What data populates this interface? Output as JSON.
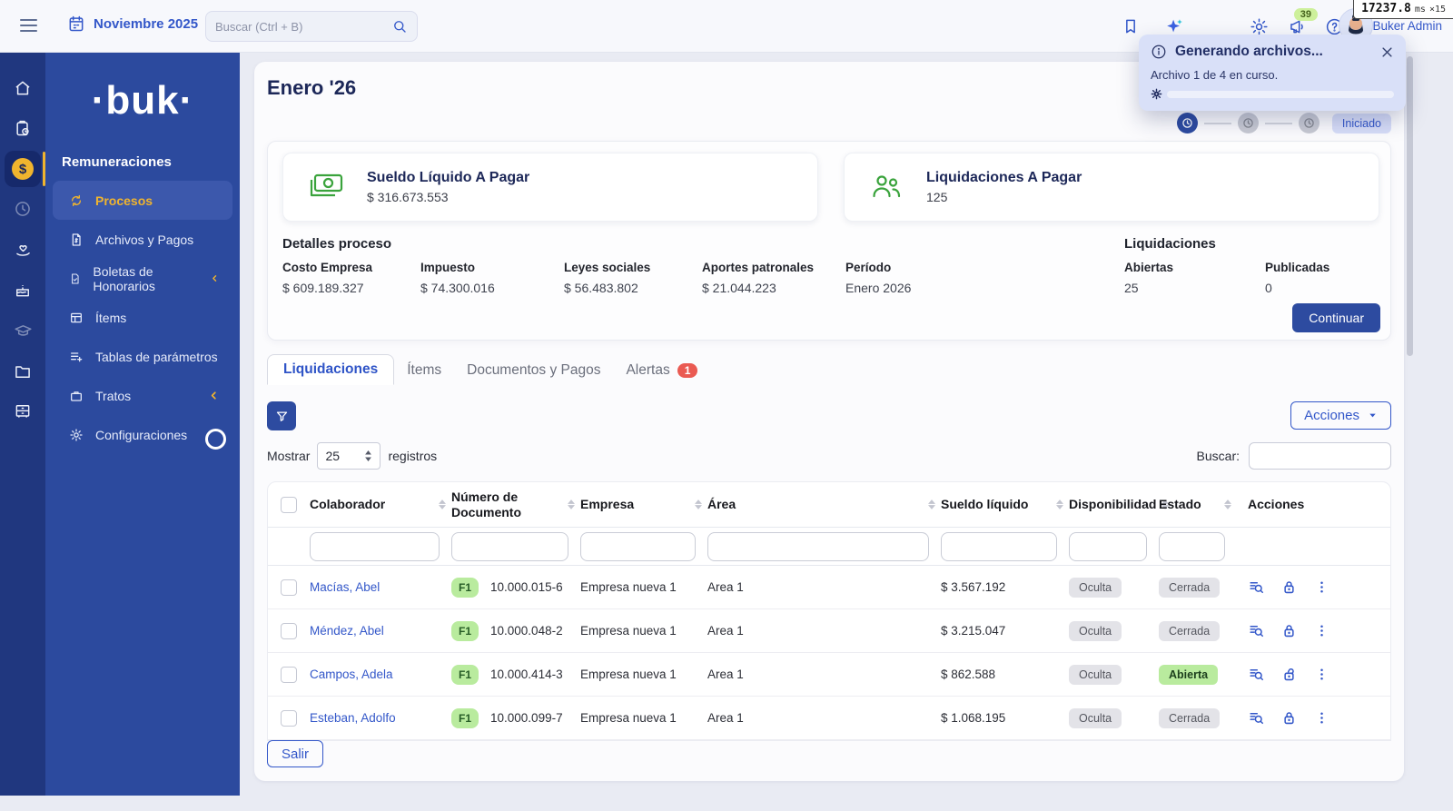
{
  "topbar": {
    "period": "Noviembre 2025",
    "search_placeholder": "Buscar (Ctrl + B)",
    "notifications_count": "39",
    "user_name": "Buker Admin",
    "timer_value": "17237.8",
    "timer_unit": "ms",
    "timer_mult": "×15"
  },
  "toast": {
    "title": "Generando archivos...",
    "body": "Archivo 1 de 4 en curso."
  },
  "sidebar": {
    "logo": "·buk·",
    "section": "Remuneraciones",
    "items": [
      {
        "label": "Procesos"
      },
      {
        "label": "Archivos y Pagos"
      },
      {
        "label": "Boletas de Honorarios"
      },
      {
        "label": "Ítems"
      },
      {
        "label": "Tablas de parámetros"
      },
      {
        "label": "Tratos"
      },
      {
        "label": "Configuraciones"
      }
    ]
  },
  "page": {
    "title": "Enero '26",
    "status_badge": "Iniciado"
  },
  "summary": {
    "cards": [
      {
        "title": "Sueldo Líquido A Pagar",
        "value": "$ 316.673.553"
      },
      {
        "title": "Liquidaciones A Pagar",
        "value": "125"
      }
    ],
    "details_title": "Detalles proceso",
    "details": [
      {
        "label": "Costo Empresa",
        "value": "$ 609.189.327"
      },
      {
        "label": "Impuesto",
        "value": "$ 74.300.016"
      },
      {
        "label": "Leyes sociales",
        "value": "$ 56.483.802"
      },
      {
        "label": "Aportes patronales",
        "value": "$ 21.044.223"
      },
      {
        "label": "Período",
        "value": "Enero 2026"
      }
    ],
    "liq_title": "Liquidaciones",
    "liq": [
      {
        "label": "Abiertas",
        "value": "25"
      },
      {
        "label": "Publicadas",
        "value": "0"
      }
    ],
    "continue_label": "Continuar"
  },
  "tabs": [
    {
      "label": "Liquidaciones"
    },
    {
      "label": "Ítems"
    },
    {
      "label": "Documentos y Pagos"
    },
    {
      "label": "Alertas",
      "badge": "1"
    }
  ],
  "controls": {
    "show_label": "Mostrar",
    "page_size": "25",
    "records_label": "registros",
    "actions_label": "Acciones",
    "search_label": "Buscar:",
    "exit_label": "Salir"
  },
  "table": {
    "columns": [
      "Colaborador",
      "Número de Documento",
      "Empresa",
      "Área",
      "Sueldo líquido",
      "Disponibilidad",
      "Estado",
      "Acciones"
    ],
    "rows": [
      {
        "name": "Macías, Abel",
        "tag": "F1",
        "doc": "10.000.015-6",
        "company": "Empresa nueva 1",
        "area": "Area 1",
        "salary": "$ 3.567.192",
        "visibility": "Oculta",
        "status": "Cerrada"
      },
      {
        "name": "Méndez, Abel",
        "tag": "F1",
        "doc": "10.000.048-2",
        "company": "Empresa nueva 1",
        "area": "Area 1",
        "salary": "$ 3.215.047",
        "visibility": "Oculta",
        "status": "Cerrada"
      },
      {
        "name": "Campos, Adela",
        "tag": "F1",
        "doc": "10.000.414-3",
        "company": "Empresa nueva 1",
        "area": "Area 1",
        "salary": "$ 862.588",
        "visibility": "Oculta",
        "status": "Abierta"
      },
      {
        "name": "Esteban, Adolfo",
        "tag": "F1",
        "doc": "10.000.099-7",
        "company": "Empresa nueva 1",
        "area": "Area 1",
        "salary": "$ 1.068.195",
        "visibility": "Oculta",
        "status": "Cerrada"
      }
    ]
  }
}
